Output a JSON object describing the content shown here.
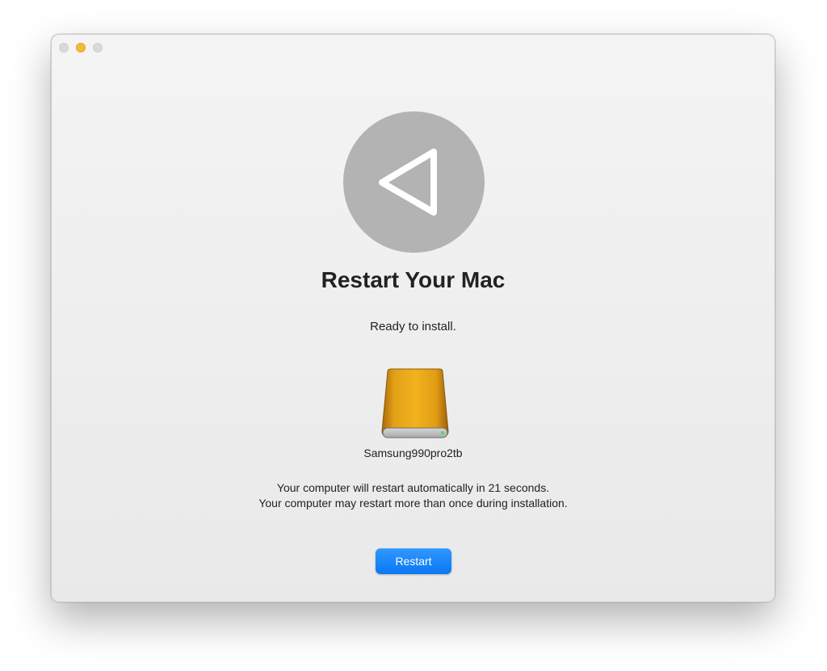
{
  "window": {
    "traffic_lights": {
      "close_color": "#d9d9d9",
      "minimize_color": "#f6b93b",
      "zoom_color": "#d9d9d9"
    }
  },
  "hero": {
    "icon": "restart-triangle-icon",
    "circle_color": "#b3b3b3"
  },
  "content": {
    "title": "Restart Your Mac",
    "subtitle": "Ready to install.",
    "disk": {
      "icon": "external-drive-icon",
      "name": "Samsung990pro2tb",
      "color": "#e8a112"
    },
    "message_line1": "Your computer will restart automatically in 21 seconds.",
    "message_line2": "Your computer may restart more than once during installation."
  },
  "actions": {
    "restart_label": "Restart",
    "accent_color": "#0a84ff"
  }
}
